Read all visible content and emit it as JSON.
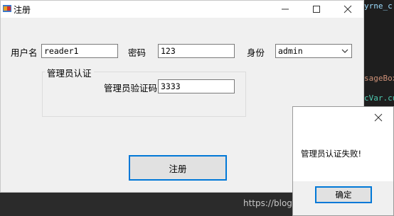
{
  "window": {
    "title": "注册",
    "colors": {
      "accent": "#0078d7",
      "titlebar": "#ffffff",
      "body": "#f0f0f0"
    }
  },
  "form": {
    "username_label": "用户名",
    "username_value": "reader1",
    "password_label": "密码",
    "password_value": "123",
    "role_label": "身份",
    "role_value": "admin",
    "admin_group_title": "管理员认证",
    "admin_code_label": "管理员验证码",
    "admin_code_value": "3333",
    "register_label": "注册"
  },
  "message_box": {
    "text": "管理员认证失败!",
    "ok_label": "确定"
  },
  "background": {
    "code_fragments": [
      "yrne_c",
      "sageBox",
      "cVar.cu"
    ],
    "watermark": "https://blog.csdn.net/lanluoro"
  }
}
